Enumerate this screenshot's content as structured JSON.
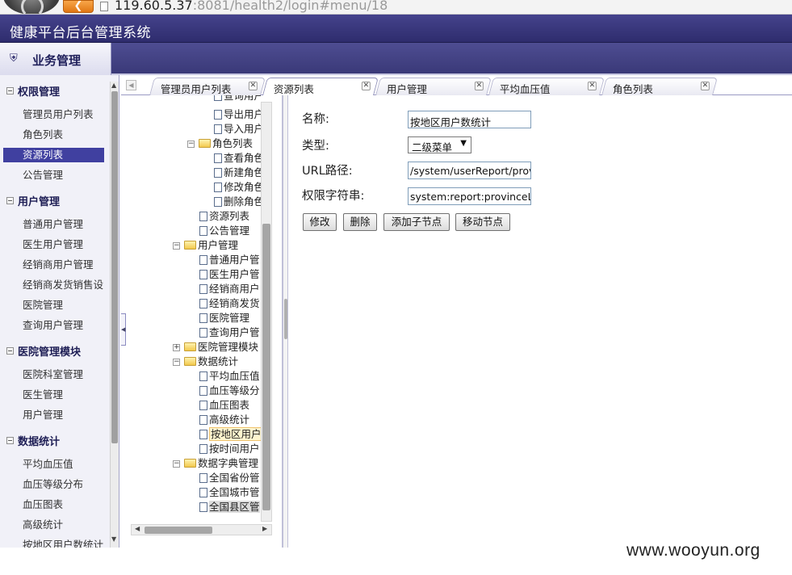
{
  "browser": {
    "url_host": "119.60.5.37",
    "url_path": ":8081/health2/login#menu/18"
  },
  "app": {
    "title": "健康平台后台管理系统"
  },
  "module": {
    "icon": "home-icon",
    "title": "业务管理"
  },
  "sidebar": {
    "sections": [
      {
        "label": "权限管理",
        "items": [
          "管理员用户列表",
          "角色列表",
          "资源列表",
          "公告管理"
        ]
      },
      {
        "label": "用户管理",
        "items": [
          "普通用户管理",
          "医生用户管理",
          "经销商用户管理",
          "经销商发货销售设",
          "医院管理",
          "查询用户管理"
        ]
      },
      {
        "label": "医院管理模块",
        "items": [
          "医院科室管理",
          "医生管理",
          "用户管理"
        ]
      },
      {
        "label": "数据统计",
        "items": [
          "平均血压值",
          "血压等级分布",
          "血压图表",
          "高级统计",
          "按地区用户数统计"
        ]
      }
    ],
    "active_item": "资源列表"
  },
  "tabs": [
    {
      "label": "管理员用户列表",
      "active": false
    },
    {
      "label": "资源列表",
      "active": true
    },
    {
      "label": "用户管理",
      "active": false
    },
    {
      "label": "平均血压值",
      "active": false
    },
    {
      "label": "角色列表",
      "active": false
    }
  ],
  "tree": {
    "nodes": [
      "查询用户",
      "导出用户",
      "导入用户",
      "角色列表",
      "查看角色",
      "新建角色",
      "修改角色",
      "删除角色",
      "资源列表",
      "公告管理",
      "用户管理",
      "普通用户管",
      "医生用户管",
      "经销商用户",
      "经销商发货",
      "医院管理",
      "查询用户管",
      "医院管理模块",
      "数据统计",
      "平均血压值",
      "血压等级分",
      "血压图表",
      "高级统计",
      "按地区用户",
      "按时间用户",
      "数据字典管理",
      "全国省份管",
      "全国城市管",
      "全国县区管"
    ],
    "selected": "按地区用户"
  },
  "form": {
    "name_label": "名称:",
    "name_value": "按地区用户数统计",
    "type_label": "类型:",
    "type_value": "二级菜单",
    "url_label": "URL路径:",
    "url_value": "/system/userReport/provinceList",
    "perm_label": "权限字符串:",
    "perm_value": "system:report:provinceList",
    "buttons": {
      "edit": "修改",
      "delete": "删除",
      "add_child": "添加子节点",
      "move": "移动节点"
    }
  },
  "watermark": "www.wooyun.org"
}
